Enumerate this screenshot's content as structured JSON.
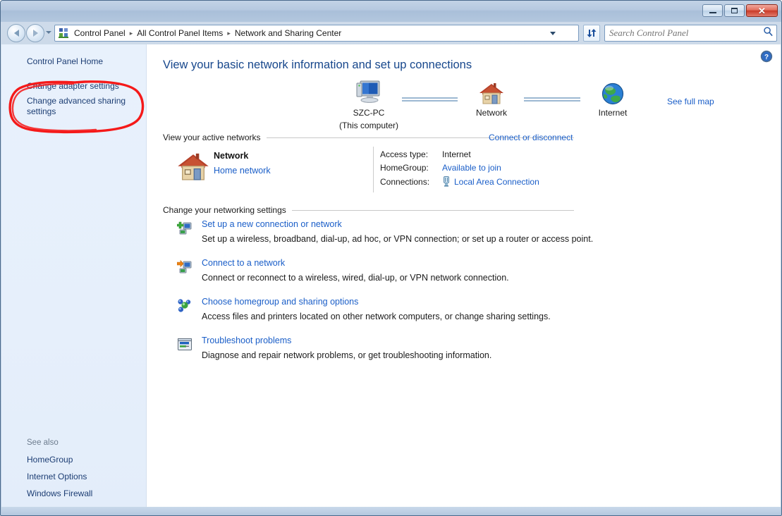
{
  "window": {
    "buttons": {
      "minimize": "minimize",
      "maximize": "maximize",
      "close": "✕"
    }
  },
  "navbar": {
    "back": "back",
    "forward": "forward",
    "breadcrumbs": [
      "Control Panel",
      "All Control Panel Items",
      "Network and Sharing Center"
    ],
    "separator": "▸",
    "refresh": "refresh"
  },
  "search": {
    "placeholder": "Search Control Panel",
    "value": ""
  },
  "sidebar": {
    "links": [
      {
        "label": "Control Panel Home"
      },
      {
        "label": "Change adapter settings"
      },
      {
        "label": "Change advanced sharing settings"
      }
    ],
    "see_also_label": "See also",
    "see_also": [
      {
        "label": "HomeGroup"
      },
      {
        "label": "Internet Options"
      },
      {
        "label": "Windows Firewall"
      }
    ],
    "annotation": {
      "target": "Change advanced sharing settings",
      "color": "#f51919",
      "shape": "hand-drawn-ellipse"
    }
  },
  "content": {
    "page_title": "View your basic network information and set up connections",
    "help": "Help",
    "network_map": {
      "nodes": [
        {
          "label": "SZC-PC",
          "sublabel": "(This computer)",
          "icon": "computer-icon"
        },
        {
          "label": "Network",
          "sublabel": "",
          "icon": "house-icon"
        },
        {
          "label": "Internet",
          "sublabel": "",
          "icon": "globe-icon"
        }
      ],
      "see_full_map": "See full map"
    },
    "active_networks": {
      "heading": "View your active networks",
      "action": "Connect or disconnect",
      "network_name": "Network",
      "network_type": "Home network",
      "details": [
        {
          "key": "Access type:",
          "value": "Internet",
          "is_link": false
        },
        {
          "key": "HomeGroup:",
          "value": "Available to join",
          "is_link": true
        },
        {
          "key": "Connections:",
          "value": "Local Area Connection",
          "is_link": true,
          "icon": "ethernet-plug-icon"
        }
      ]
    },
    "networking_settings": {
      "heading": "Change your networking settings",
      "items": [
        {
          "icon": "new-connection-icon",
          "link": "Set up a new connection or network",
          "description": "Set up a wireless, broadband, dial-up, ad hoc, or VPN connection; or set up a router or access point."
        },
        {
          "icon": "connect-network-icon",
          "link": "Connect to a network",
          "description": "Connect or reconnect to a wireless, wired, dial-up, or VPN network connection."
        },
        {
          "icon": "homegroup-icon",
          "link": "Choose homegroup and sharing options",
          "description": "Access files and printers located on other network computers, or change sharing settings."
        },
        {
          "icon": "troubleshoot-icon",
          "link": "Troubleshoot problems",
          "description": "Diagnose and repair network problems, or get troubleshooting information."
        }
      ]
    }
  },
  "colors": {
    "link": "#1a5ec8",
    "title": "#17478c",
    "sidebar_bg": "#e8f1fc",
    "annotation_red": "#f51919"
  }
}
